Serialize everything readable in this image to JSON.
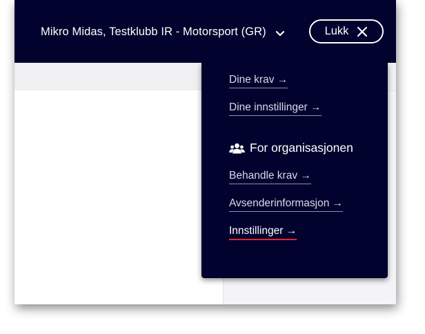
{
  "header": {
    "org_name": "Mikro Midas, Testklubb IR - Motorsport (GR)",
    "org_chevron_icon": "chevron-down-icon",
    "close_label": "Lukk",
    "close_icon": "close-icon"
  },
  "menu": {
    "personal_links": [
      {
        "label": "Dine krav →"
      },
      {
        "label": "Dine innstillinger →"
      }
    ],
    "org_section": {
      "icon": "people-icon",
      "heading": "For organisasjonen"
    },
    "org_links": [
      {
        "label": "Behandle krav →"
      },
      {
        "label": "Avsenderinformasjon →"
      },
      {
        "label": "Innstillinger →",
        "active": true
      }
    ]
  },
  "colors": {
    "topbar_bg": "#02022e",
    "active_underline": "#e0262a",
    "page_bg": "#f4f3f5"
  }
}
